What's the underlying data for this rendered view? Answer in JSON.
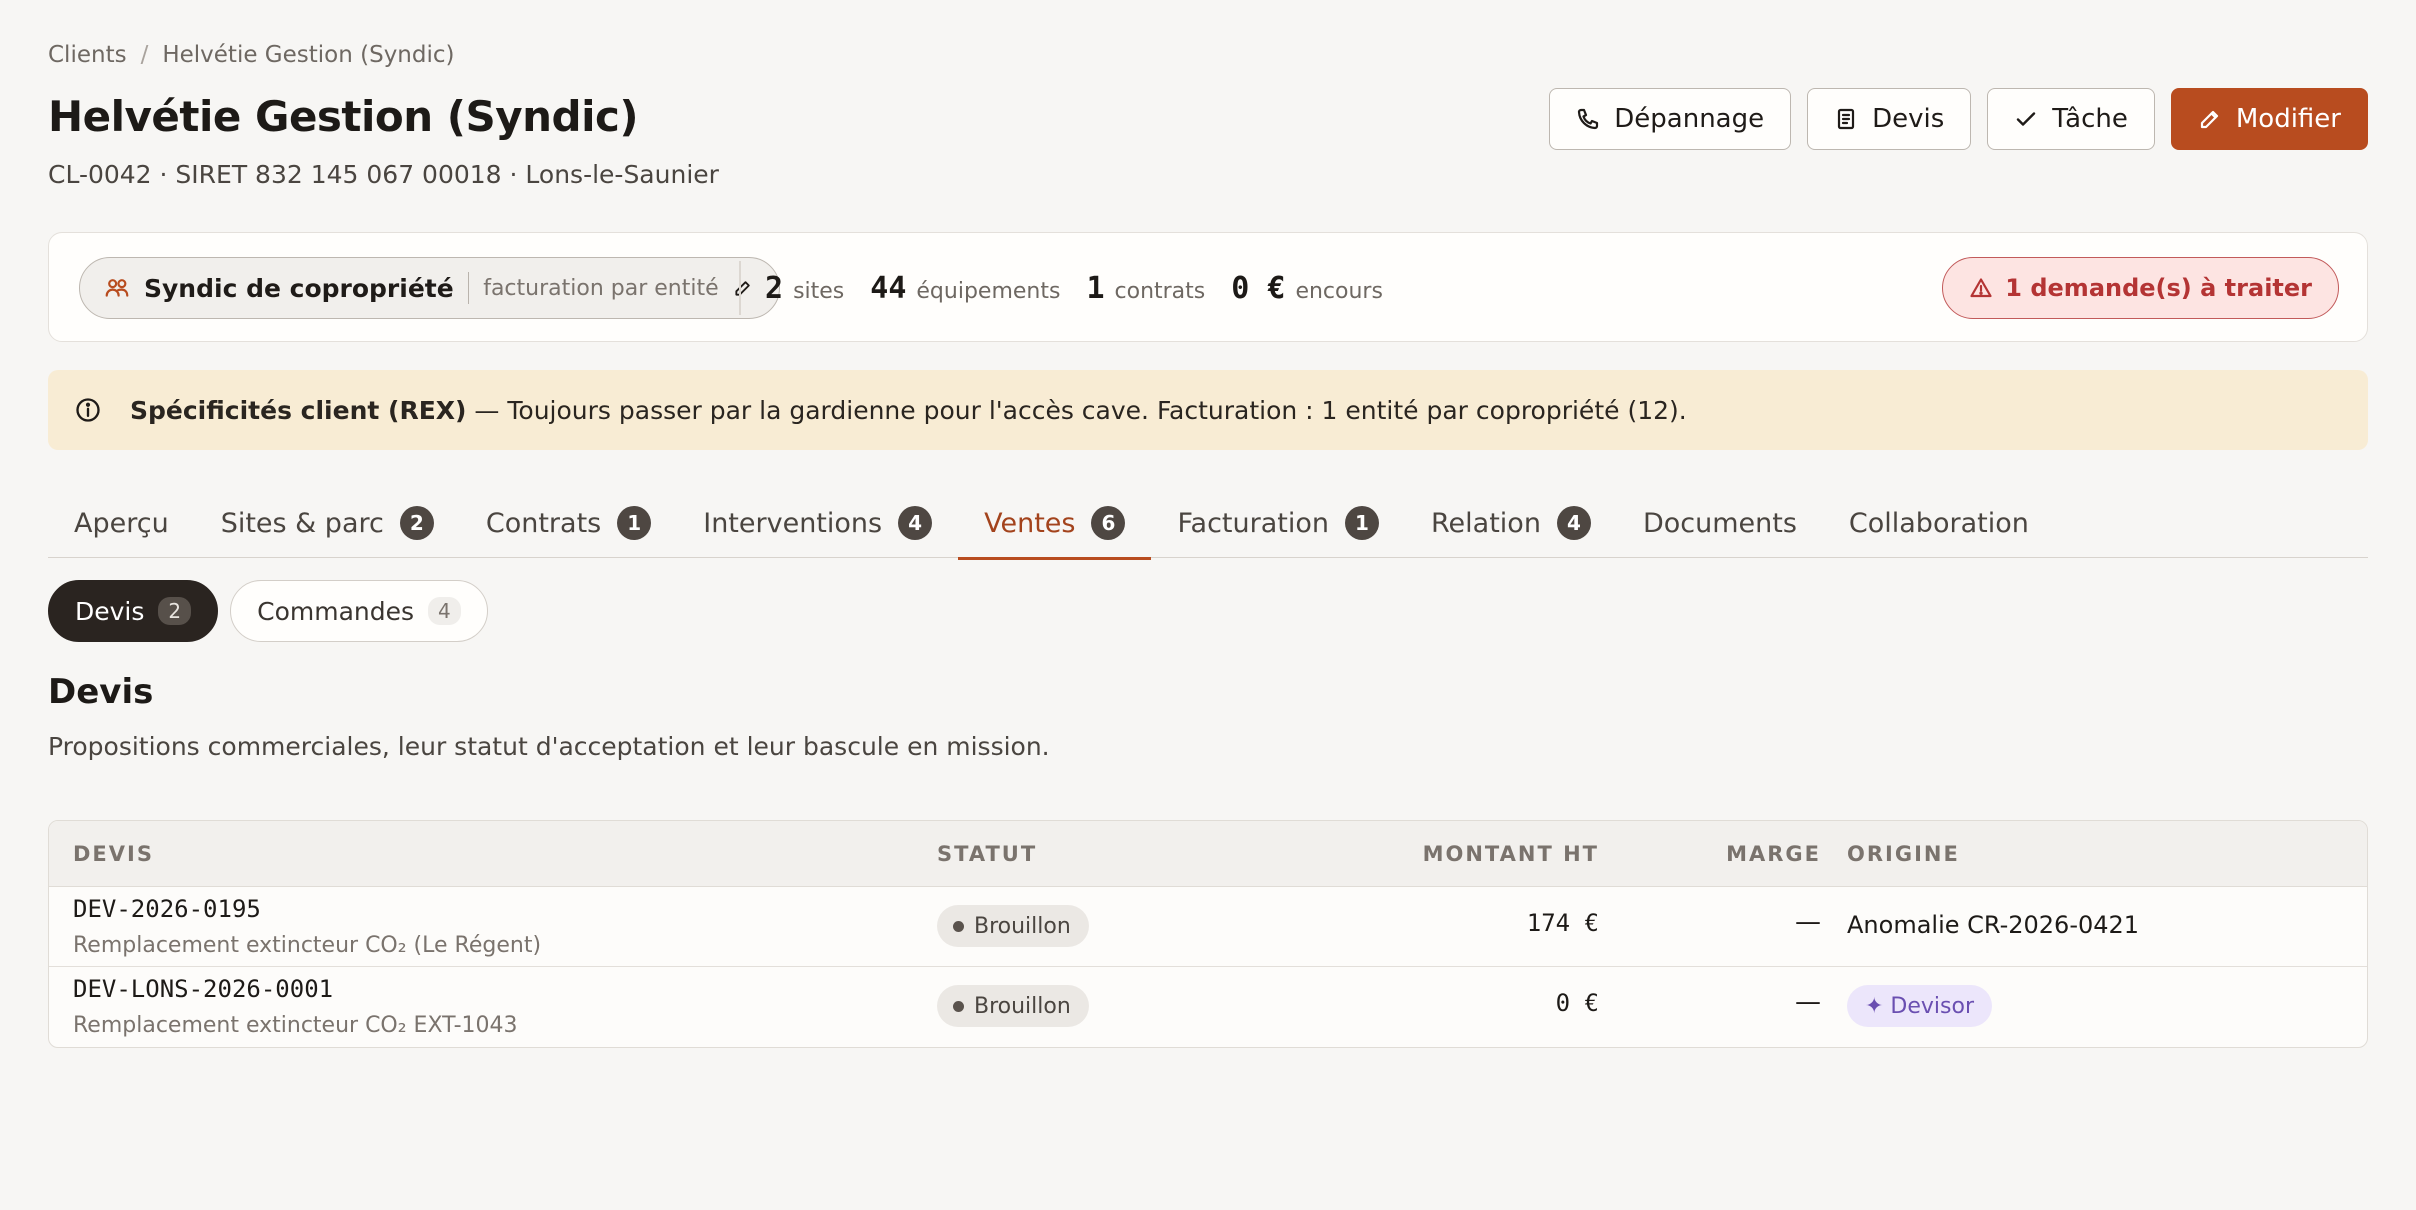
{
  "breadcrumb": {
    "root": "Clients",
    "separator": "/",
    "current": "Helvétie Gestion (Syndic)"
  },
  "header": {
    "title": "Helvétie Gestion (Syndic)",
    "subtitle": "CL-0042 · SIRET 832 145 067 00018 · Lons-le-Saunier"
  },
  "actions": {
    "depannage": "Dépannage",
    "devis": "Devis",
    "tache": "Tâche",
    "modifier": "Modifier"
  },
  "summary": {
    "type_label": "Syndic de copropriété",
    "billing_label": "facturation par entité",
    "stats": [
      {
        "n": "2",
        "u": "sites"
      },
      {
        "n": "44",
        "u": "équipements"
      },
      {
        "n": "1",
        "u": "contrats"
      },
      {
        "n": "0 €",
        "u": "encours"
      }
    ],
    "alert": "1 demande(s) à traiter"
  },
  "notice": {
    "title": "Spécificités client (REX)",
    "text": " — Toujours passer par la gardienne pour l'accès cave. Facturation : 1 entité par copropriété (12)."
  },
  "tabs": [
    {
      "label": "Aperçu",
      "badge": ""
    },
    {
      "label": "Sites & parc",
      "badge": "2"
    },
    {
      "label": "Contrats",
      "badge": "1"
    },
    {
      "label": "Interventions",
      "badge": "4"
    },
    {
      "label": "Ventes",
      "badge": "6"
    },
    {
      "label": "Facturation",
      "badge": "1"
    },
    {
      "label": "Relation",
      "badge": "4"
    },
    {
      "label": "Documents",
      "badge": ""
    },
    {
      "label": "Collaboration",
      "badge": ""
    }
  ],
  "subtabs": [
    {
      "label": "Devis",
      "count": "2"
    },
    {
      "label": "Commandes",
      "count": "4"
    }
  ],
  "section": {
    "title": "Devis",
    "description": "Propositions commerciales, leur statut d'acceptation et leur bascule en mission."
  },
  "table": {
    "headers": {
      "devis": "DEVIS",
      "statut": "STATUT",
      "montant": "MONTANT HT",
      "marge": "MARGE",
      "origine": "ORIGINE"
    },
    "rows": [
      {
        "code": "DEV-2026-0195",
        "desc": "Remplacement extincteur CO₂ (Le Régent)",
        "status": "Brouillon",
        "amount": "174 €",
        "marge": "—",
        "origin": "Anomalie CR-2026-0421"
      },
      {
        "code": "DEV-LONS-2026-0001",
        "desc": "Remplacement extincteur CO₂ EXT-1043",
        "status": "Brouillon",
        "amount": "0 €",
        "marge": "—",
        "origin": "✦ Devisor"
      }
    ]
  },
  "colors": {
    "accent": "#b84c1f",
    "alert": "#b43434",
    "notice_bg": "#f8ecd4",
    "origin_pill": "#6a4fb1"
  }
}
